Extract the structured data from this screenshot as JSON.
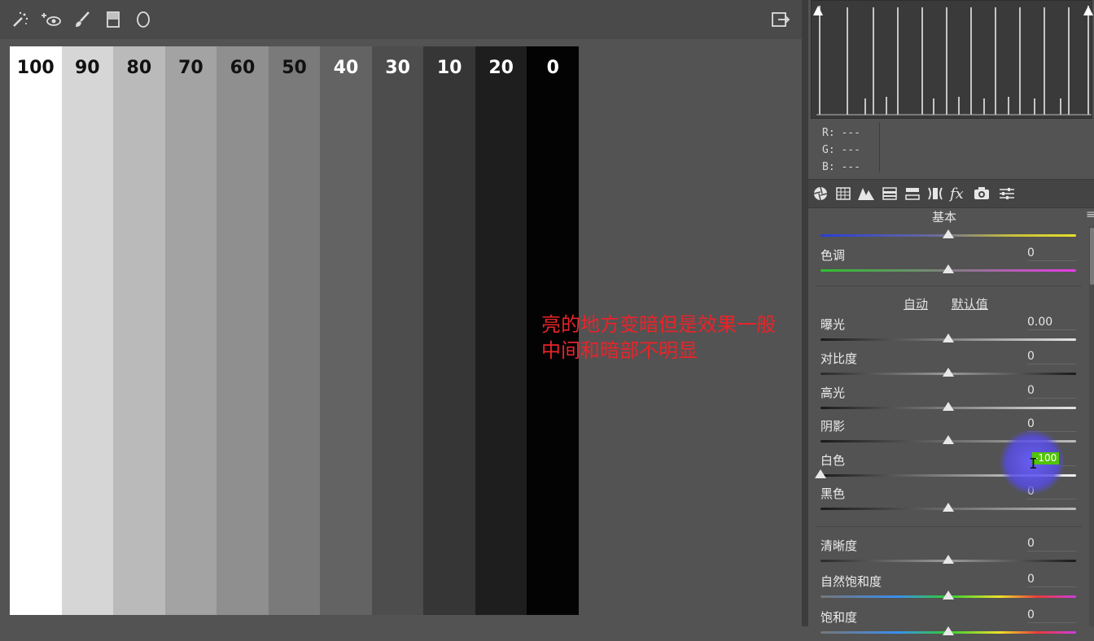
{
  "toolbar": {
    "tools": [
      "spot-removal-tool",
      "red-eye-tool",
      "adjustment-brush-tool",
      "graduated-filter-tool",
      "radial-filter-tool"
    ],
    "export_icon": "export-icon"
  },
  "swatches": [
    {
      "label": "100",
      "color": "#ffffff",
      "text_color": "#111111"
    },
    {
      "label": "90",
      "color": "#d6d6d6",
      "text_color": "#111111"
    },
    {
      "label": "80",
      "color": "#bababa",
      "text_color": "#111111"
    },
    {
      "label": "70",
      "color": "#a3a3a3",
      "text_color": "#111111"
    },
    {
      "label": "60",
      "color": "#8f8f8f",
      "text_color": "#111111"
    },
    {
      "label": "50",
      "color": "#7a7a7a",
      "text_color": "#111111"
    },
    {
      "label": "40",
      "color": "#636363",
      "text_color": "#ffffff"
    },
    {
      "label": "30",
      "color": "#4d4d4d",
      "text_color": "#ffffff"
    },
    {
      "label": "10",
      "color": "#363636",
      "text_color": "#ffffff"
    },
    {
      "label": "20",
      "color": "#1e1e1e",
      "text_color": "#ffffff"
    },
    {
      "label": "0",
      "color": "#030303",
      "text_color": "#ffffff"
    }
  ],
  "annotation": {
    "line1": "亮的地方变暗但是效果一般",
    "line2": "中间和暗部不明显",
    "color": "#e8242a"
  },
  "rgb_readout": {
    "r": "R: ---",
    "g": "G: ---",
    "b": "B: ---"
  },
  "panel_tabs": [
    "basic-icon",
    "tone-curve-icon",
    "detail-icon",
    "hsl-icon",
    "split-toning-icon",
    "lens-corrections-icon",
    "effects-icon",
    "camera-calibration-icon",
    "presets-icon"
  ],
  "section": {
    "title": "基本",
    "menu_icon": "≡"
  },
  "auto_links": {
    "auto": "自动",
    "default": "默认值"
  },
  "sliders": [
    {
      "key": "temperature",
      "label": "",
      "value": "",
      "position": 0.5
    },
    {
      "key": "tint",
      "label": "色调",
      "value": "0",
      "position": 0.5
    },
    {
      "key": "exposure",
      "label": "曝光",
      "value": "0.00",
      "position": 0.5
    },
    {
      "key": "contrast",
      "label": "对比度",
      "value": "0",
      "position": 0.5
    },
    {
      "key": "highlights",
      "label": "高光",
      "value": "0",
      "position": 0.5
    },
    {
      "key": "shadows",
      "label": "阴影",
      "value": "0",
      "position": 0.5
    },
    {
      "key": "whites",
      "label": "白色",
      "value": "",
      "position": 0.0
    },
    {
      "key": "blacks",
      "label": "黑色",
      "value": "0",
      "position": 0.5
    },
    {
      "key": "clarity",
      "label": "清晰度",
      "value": "0",
      "position": 0.5
    },
    {
      "key": "vibrance",
      "label": "自然饱和度",
      "value": "0",
      "position": 0.5
    },
    {
      "key": "saturation",
      "label": "饱和度",
      "value": "0",
      "position": 0.5
    }
  ],
  "editing_value": "-100"
}
